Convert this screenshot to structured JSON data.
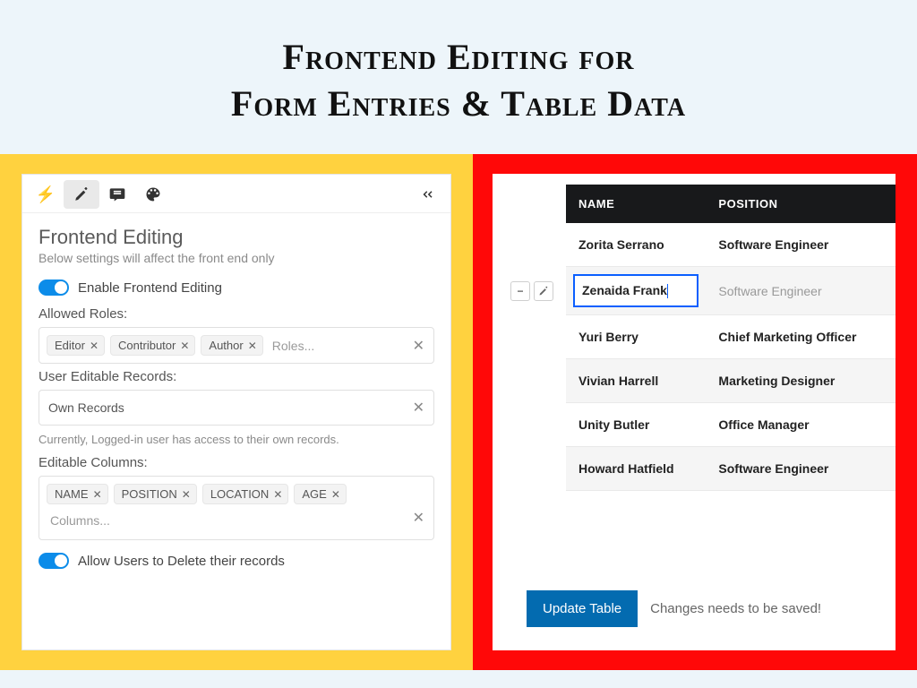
{
  "title": {
    "line1": "Frontend Editing for",
    "line2": "Form Entries & Table Data"
  },
  "leftPanel": {
    "heading": "Frontend Editing",
    "sub": "Below settings will affect the front end only",
    "enableLabel": "Enable Frontend Editing",
    "allowedRolesLabel": "Allowed Roles:",
    "roles": {
      "r0": "Editor",
      "r1": "Contributor",
      "r2": "Author"
    },
    "rolesPlaceholder": "Roles...",
    "userEditableLabel": "User Editable Records:",
    "userEditableValue": "Own Records",
    "helpText": "Currently, Logged-in user has access to their own records.",
    "editableColumnsLabel": "Editable Columns:",
    "columns": {
      "c0": "NAME",
      "c1": "POSITION",
      "c2": "LOCATION",
      "c3": "AGE"
    },
    "columnsPlaceholder": "Columns...",
    "allowDeleteLabel": "Allow Users to Delete their records"
  },
  "rightPanel": {
    "headers": {
      "h0": "NAME",
      "h1": "POSITION"
    },
    "rows": {
      "r0": {
        "name": "Zorita Serrano",
        "position": "Software Engineer"
      },
      "r1": {
        "name": "Zenaida Frank",
        "position": "Software Engineer"
      },
      "r2": {
        "name": "Yuri Berry",
        "position": "Chief Marketing Officer"
      },
      "r3": {
        "name": "Vivian Harrell",
        "position": "Marketing Designer"
      },
      "r4": {
        "name": "Unity Butler",
        "position": "Office Manager"
      },
      "r5": {
        "name": "Howard Hatfield",
        "position": "Software Engineer"
      }
    },
    "updateBtn": "Update Table",
    "saveMsg": "Changes needs to be saved!"
  }
}
